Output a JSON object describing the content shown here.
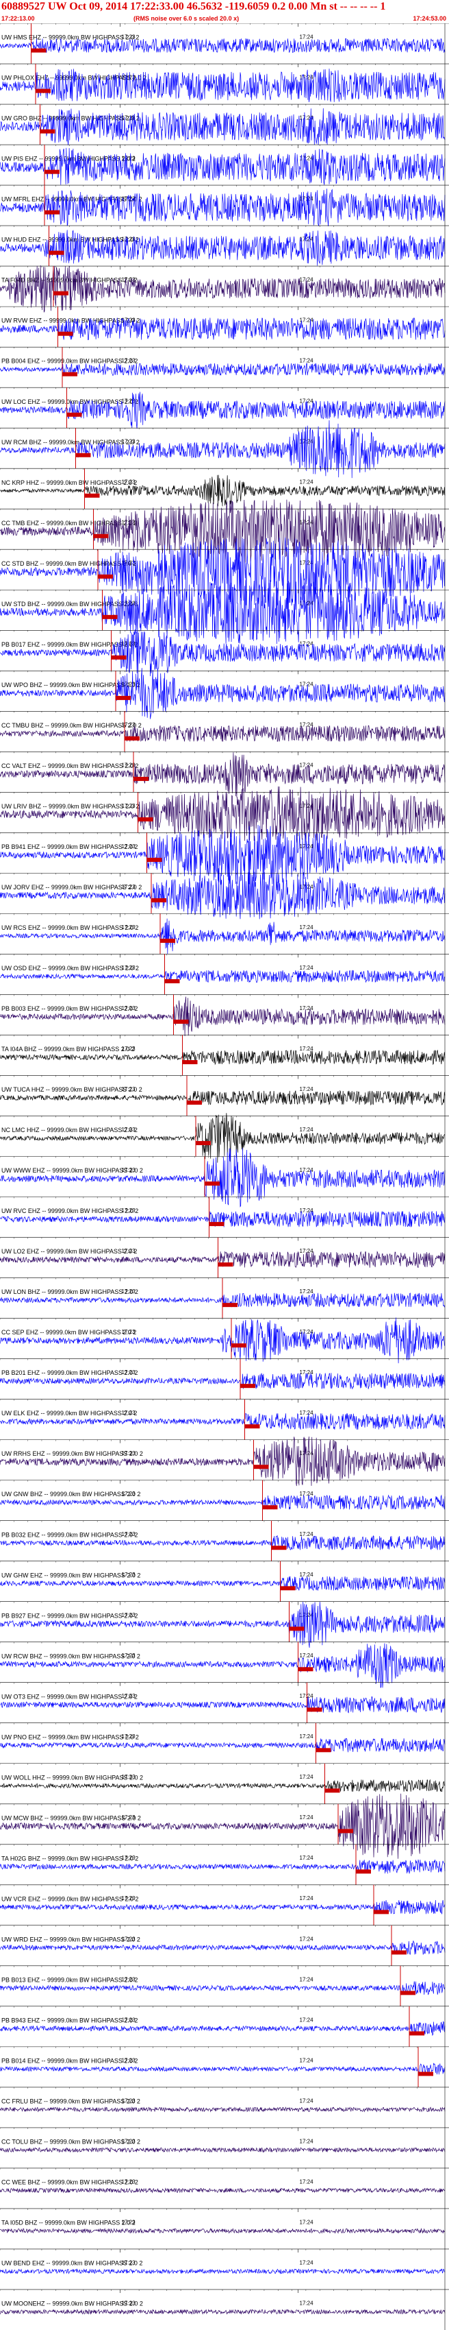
{
  "header": {
    "title": "60889527 UW Oct 09, 2014 17:22:33.00   46.5632 -119.6059  0.2 0.00 Mn st -- -- -- -- 1",
    "start_time": "17:22:13.00",
    "noise_note": "(RMS noise over 6.0 s scaled 20.0 x)",
    "end_time": "17:24:53.00"
  },
  "time_marks": [
    "17:23",
    "17:24"
  ],
  "colors": {
    "accent": "#e00000",
    "blue_trace": "#0000ff",
    "dark_trace": "#2a0060",
    "black_trace": "#000000",
    "pick": "#cc0000",
    "grid": "#000000"
  },
  "traces": [
    {
      "label": "UW HMS EHZ -- 99999.0km BW  HIGHPASS  2.0  2",
      "color": "blue",
      "amp": 0.35,
      "pick": 0.07,
      "burst": []
    },
    {
      "label": "UW PHLOX EHZ -- 99999.0km BW  HIGHPASS  2.0  2",
      "color": "blue",
      "amp": 0.7,
      "pick": 0.08,
      "burst": [
        [
          0.1,
          0.2,
          0.9
        ],
        [
          0.65,
          0.8,
          0.9
        ]
      ]
    },
    {
      "label": "UW GRO BHZ -- 99999.0km BW  HIGHPASS  2.0  2",
      "color": "blue",
      "amp": 0.7,
      "pick": 0.09,
      "burst": [
        [
          0.1,
          0.2,
          0.95
        ],
        [
          0.65,
          0.8,
          0.95
        ]
      ]
    },
    {
      "label": "UW PIS EHZ -- 99999.0km BW  HIGHPASS  2.0  2",
      "color": "blue",
      "amp": 0.7,
      "pick": 0.1,
      "burst": [
        [
          0.1,
          0.2,
          0.95
        ],
        [
          0.65,
          0.8,
          0.95
        ]
      ]
    },
    {
      "label": "UW MFRL EHZ -- 99999.0km BW  HIGHPASS  2.0  2",
      "color": "blue",
      "amp": 0.7,
      "pick": 0.1,
      "burst": [
        [
          0.1,
          0.2,
          0.95
        ],
        [
          0.65,
          0.8,
          0.95
        ]
      ]
    },
    {
      "label": "UW HUD EHZ -- 99999.0km BW  HIGHPASS  2.0  2",
      "color": "blue",
      "amp": 0.6,
      "pick": 0.11,
      "burst": [
        [
          0.1,
          0.2,
          0.9
        ],
        [
          0.65,
          0.8,
          0.9
        ]
      ]
    },
    {
      "label": "TA F04D BHZ -- 99999.0km BW  HIGHPASS  2.0  2",
      "color": "dark",
      "amp": 0.5,
      "pick": 0.12,
      "burst": [
        [
          0.02,
          0.22,
          1.2
        ]
      ]
    },
    {
      "label": "UW RVW EHZ -- 99999.0km BW  HIGHPASS  2.0  2",
      "color": "blue",
      "amp": 0.55,
      "pick": 0.13,
      "burst": []
    },
    {
      "label": "PB B004 EHZ -- 99999.0km BW  HIGHPASS  2.0  2",
      "color": "blue",
      "amp": 0.3,
      "pick": 0.14,
      "burst": []
    },
    {
      "label": "UW LOC EHZ -- 99999.0km BW  HIGHPASS  2.0  2",
      "color": "blue",
      "amp": 0.45,
      "pick": 0.15,
      "burst": [
        [
          0.28,
          0.33,
          1.0
        ]
      ]
    },
    {
      "label": "UW RCM BHZ -- 99999.0km BW  HIGHPASS  2.0  2",
      "color": "blue",
      "amp": 0.4,
      "pick": 0.17,
      "burst": [
        [
          0.65,
          0.85,
          1.5
        ]
      ]
    },
    {
      "label": "NC KRP HHZ -- 99999.0km BW  HIGHPASS  2.0  2",
      "color": "black",
      "amp": 0.25,
      "pick": 0.19,
      "burst": [
        [
          0.45,
          0.55,
          0.8
        ]
      ]
    },
    {
      "label": "CC TMB EHZ -- 99999.0km BW  HIGHPASS  2.0  2",
      "color": "dark",
      "amp": 0.6,
      "pick": 0.21,
      "burst": [
        [
          0.23,
          1.0,
          1.6
        ]
      ]
    },
    {
      "label": "CC STD BHZ -- 99999.0km BW  HIGHPASS  2.0  2",
      "color": "blue",
      "amp": 0.6,
      "pick": 0.22,
      "burst": [
        [
          0.23,
          1.0,
          1.7
        ]
      ]
    },
    {
      "label": "UW STD BHZ -- 99999.0km BW  HIGHPASS  2.0  3",
      "color": "blue",
      "amp": 0.55,
      "pick": 0.23,
      "burst": [
        [
          0.23,
          0.95,
          1.6
        ]
      ]
    },
    {
      "label": "PB B017 EHZ -- 99999.0km BW  HIGHPASS  2.0  2",
      "color": "blue",
      "amp": 0.45,
      "pick": 0.25,
      "burst": [
        [
          0.26,
          0.4,
          1.3
        ]
      ]
    },
    {
      "label": "UW WPO BHZ -- 99999.0km BW  HIGHPASS  2.0  2",
      "color": "blue",
      "amp": 0.45,
      "pick": 0.26,
      "burst": [
        [
          0.26,
          0.4,
          1.3
        ]
      ]
    },
    {
      "label": "CC TMBU BHZ -- 99999.0km BW  HIGHPASS  2.0  2",
      "color": "dark",
      "amp": 0.4,
      "pick": 0.28,
      "burst": []
    },
    {
      "label": "CC VALT EHZ -- 99999.0km BW  HIGHPASS  2.0  2",
      "color": "dark",
      "amp": 0.5,
      "pick": 0.3,
      "burst": [
        [
          0.5,
          0.56,
          1.2
        ]
      ]
    },
    {
      "label": "UW LRIV BHZ -- 99999.0km BW  HIGHPASS  2.0  2",
      "color": "dark",
      "amp": 0.55,
      "pick": 0.31,
      "burst": [
        [
          0.31,
          1.0,
          1.4
        ]
      ]
    },
    {
      "label": "PB B941 EHZ -- 99999.0km BW  HIGHPASS  2.0  2",
      "color": "blue",
      "amp": 0.45,
      "pick": 0.33,
      "burst": [
        [
          0.33,
          0.78,
          1.5
        ]
      ]
    },
    {
      "label": "UW JORV EHZ -- 99999.0km BW  HIGHPASS  2.0  2",
      "color": "blue",
      "amp": 0.45,
      "pick": 0.34,
      "burst": [
        [
          0.34,
          0.8,
          1.2
        ]
      ]
    },
    {
      "label": "UW RCS EHZ -- 99999.0km BW  HIGHPASS  2.0  2",
      "color": "blue",
      "amp": 0.3,
      "pick": 0.36,
      "burst": [
        [
          0.36,
          0.4,
          1.0
        ],
        [
          0.6,
          0.62,
          1.0
        ]
      ]
    },
    {
      "label": "UW OSD EHZ -- 99999.0km BW  HIGHPASS  2.0  2",
      "color": "blue",
      "amp": 0.3,
      "pick": 0.37,
      "burst": []
    },
    {
      "label": "PB B003 EHZ -- 99999.0km BW  HIGHPASS  2.0  2",
      "color": "dark",
      "amp": 0.4,
      "pick": 0.39,
      "burst": [
        [
          0.39,
          0.45,
          1.0
        ]
      ]
    },
    {
      "label": "TA I04A BHZ -- 99999.0km BW  HIGHPASS  2.0  2",
      "color": "black",
      "amp": 0.35,
      "pick": 0.41,
      "burst": []
    },
    {
      "label": "UW TUCA HHZ -- 99999.0km BW  HIGHPASS  2.0  2",
      "color": "black",
      "amp": 0.35,
      "pick": 0.42,
      "burst": []
    },
    {
      "label": "NC LMC HHZ -- 99999.0km BW  HIGHPASS  2.0  2",
      "color": "black",
      "amp": 0.3,
      "pick": 0.44,
      "burst": [
        [
          0.44,
          0.55,
          1.3
        ]
      ]
    },
    {
      "label": "UW WWW EHZ -- 99999.0km BW  HIGHPASS  2.0  2",
      "color": "blue",
      "amp": 0.45,
      "pick": 0.46,
      "burst": [
        [
          0.46,
          0.6,
          1.6
        ]
      ]
    },
    {
      "label": "UW RVC EHZ -- 99999.0km BW  HIGHPASS  2.0  2",
      "color": "blue",
      "amp": 0.4,
      "pick": 0.47,
      "burst": []
    },
    {
      "label": "UW LO2 EHZ -- 99999.0km BW  HIGHPASS  2.0  2",
      "color": "dark",
      "amp": 0.4,
      "pick": 0.49,
      "burst": []
    },
    {
      "label": "UW LON BHZ -- 99999.0km BW  HIGHPASS  2.0  2",
      "color": "blue",
      "amp": 0.35,
      "pick": 0.5,
      "burst": []
    },
    {
      "label": "CC SEP EHZ -- 99999.0km BW  HIGHPASS  2.0  2",
      "color": "blue",
      "amp": 0.45,
      "pick": 0.52,
      "burst": [
        [
          0.5,
          0.65,
          1.1
        ],
        [
          0.85,
          0.95,
          1.2
        ]
      ]
    },
    {
      "label": "PB B201 EHZ -- 99999.0km BW  HIGHPASS  2.0  2",
      "color": "blue",
      "amp": 0.4,
      "pick": 0.54,
      "burst": []
    },
    {
      "label": "UW ELK EHZ -- 99999.0km BW  HIGHPASS  2.0  2",
      "color": "blue",
      "amp": 0.4,
      "pick": 0.55,
      "burst": []
    },
    {
      "label": "UW RRHS EHZ -- 99999.0km BW  HIGHPASS  2.0  2",
      "color": "dark",
      "amp": 0.5,
      "pick": 0.57,
      "burst": [
        [
          0.57,
          0.8,
          1.3
        ]
      ]
    },
    {
      "label": "UW GNW BHZ -- 99999.0km BW  HIGHPASS  2.0  2",
      "color": "blue",
      "amp": 0.35,
      "pick": 0.59,
      "burst": []
    },
    {
      "label": "PB B032 EHZ -- 99999.0km BW  HIGHPASS  2.0  2",
      "color": "blue",
      "amp": 0.35,
      "pick": 0.61,
      "burst": []
    },
    {
      "label": "UW GHW EHZ -- 99999.0km BW  HIGHPASS  2.0  2",
      "color": "blue",
      "amp": 0.35,
      "pick": 0.63,
      "burst": []
    },
    {
      "label": "PB B927 EHZ -- 99999.0km BW  HIGHPASS  2.0  2",
      "color": "blue",
      "amp": 0.45,
      "pick": 0.65,
      "burst": [
        [
          0.65,
          0.75,
          1.2
        ]
      ]
    },
    {
      "label": "UW RCW BHZ -- 99999.0km BW  HIGHPASS  2.0  2",
      "color": "blue",
      "amp": 0.4,
      "pick": 0.67,
      "burst": [
        [
          0.8,
          0.9,
          1.2
        ]
      ]
    },
    {
      "label": "UW OT3 EHZ -- 99999.0km BW  HIGHPASS  2.0  2",
      "color": "blue",
      "amp": 0.4,
      "pick": 0.69,
      "burst": []
    },
    {
      "label": "UW PNO EHZ -- 99999.0km BW  HIGHPASS  2.0  2",
      "color": "blue",
      "amp": 0.35,
      "pick": 0.71,
      "burst": []
    },
    {
      "label": "UW WOLL HHZ -- 99999.0km BW  HIGHPASS  2.0  2",
      "color": "black",
      "amp": 0.3,
      "pick": 0.73,
      "burst": []
    },
    {
      "label": "UW MCW BHZ -- 99999.0km BW  HIGHPASS  2.0  2",
      "color": "dark",
      "amp": 0.45,
      "pick": 0.76,
      "burst": [
        [
          0.76,
          1.0,
          1.7
        ]
      ]
    },
    {
      "label": "TA H02G BHZ -- 99999.0km BW  HIGHPASS  2.0  2",
      "color": "blue",
      "amp": 0.35,
      "pick": 0.8,
      "burst": []
    },
    {
      "label": "UW VCR EHZ -- 99999.0km BW  HIGHPASS  2.0  2",
      "color": "blue",
      "amp": 0.35,
      "pick": 0.84,
      "burst": []
    },
    {
      "label": "UW WRD EHZ -- 99999.0km BW  HIGHPASS  2.0  2",
      "color": "blue",
      "amp": 0.35,
      "pick": 0.88,
      "burst": []
    },
    {
      "label": "PB B013 EHZ -- 99999.0km BW  HIGHPASS  2.0  2",
      "color": "blue",
      "amp": 0.35,
      "pick": 0.9,
      "burst": []
    },
    {
      "label": "PB B943 EHZ -- 99999.0km BW  HIGHPASS  2.0  2",
      "color": "blue",
      "amp": 0.35,
      "pick": 0.92,
      "burst": []
    },
    {
      "label": "PB B014 EHZ -- 99999.0km BW  HIGHPASS  2.0  2",
      "color": "blue",
      "amp": 0.3,
      "pick": 0.94,
      "burst": []
    },
    {
      "label": "CC FRLU BHZ -- 99999.0km BW  HIGHPASS  2.0  2",
      "color": "dark",
      "amp": 0.3,
      "pick": null,
      "burst": []
    },
    {
      "label": "CC TOLU BHZ -- 99999.0km BW  HIGHPASS  2.0  2",
      "color": "dark",
      "amp": 0.3,
      "pick": null,
      "burst": []
    },
    {
      "label": "CC WEE BHZ -- 99999.0km BW  HIGHPASS  2.0  2",
      "color": "dark",
      "amp": 0.3,
      "pick": null,
      "burst": []
    },
    {
      "label": "TA I05D BHZ -- 99999.0km BW  HIGHPASS  2.0  2",
      "color": "dark",
      "amp": 0.3,
      "pick": null,
      "burst": []
    },
    {
      "label": "UW BEND EHZ -- 99999.0km BW  HIGHPASS  2.0  2",
      "color": "blue",
      "amp": 0.3,
      "pick": null,
      "burst": []
    },
    {
      "label": "UW MOONEHZ -- 99999.0km BW  HIGHPASS  2.0  2",
      "color": "dark",
      "amp": 0.3,
      "pick": null,
      "burst": []
    }
  ]
}
